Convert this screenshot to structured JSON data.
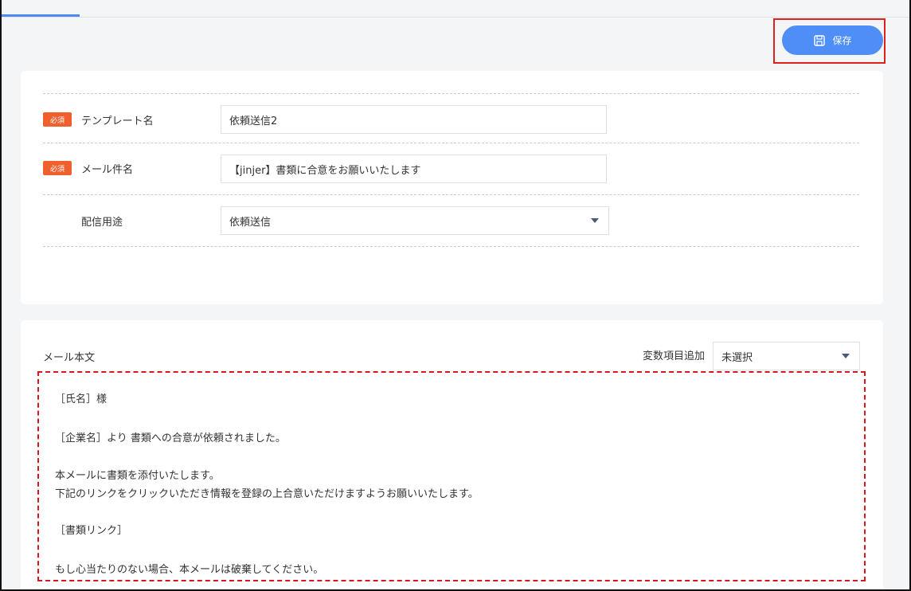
{
  "header": {
    "save_label": "保存"
  },
  "form": {
    "required_badge": "必須",
    "template_name": {
      "label": "テンプレート名",
      "value": "依頼送信2"
    },
    "mail_subject": {
      "label": "メール件名",
      "value": "【jinjer】書類に合意をお願いいたします"
    },
    "delivery_use": {
      "label": "配信用途",
      "selected": "依頼送信"
    }
  },
  "mail_body": {
    "label": "メール本文",
    "variable_label": "変数項目追加",
    "variable_selected": "未選択",
    "lines": [
      "［氏名］様",
      "［企業名］より 書類への合意が依頼されました。",
      "本メールに書類を添付いたします。",
      "下記のリンクをクリックいただき情報を登録の上合意いただけますようお願いいたします。",
      "［書類リンク］",
      "もし心当たりのない場合、本メールは破棄してください。"
    ]
  },
  "colors": {
    "accent": "#4f8ef7",
    "badge": "#f0602f",
    "highlight": "#e0201b"
  }
}
